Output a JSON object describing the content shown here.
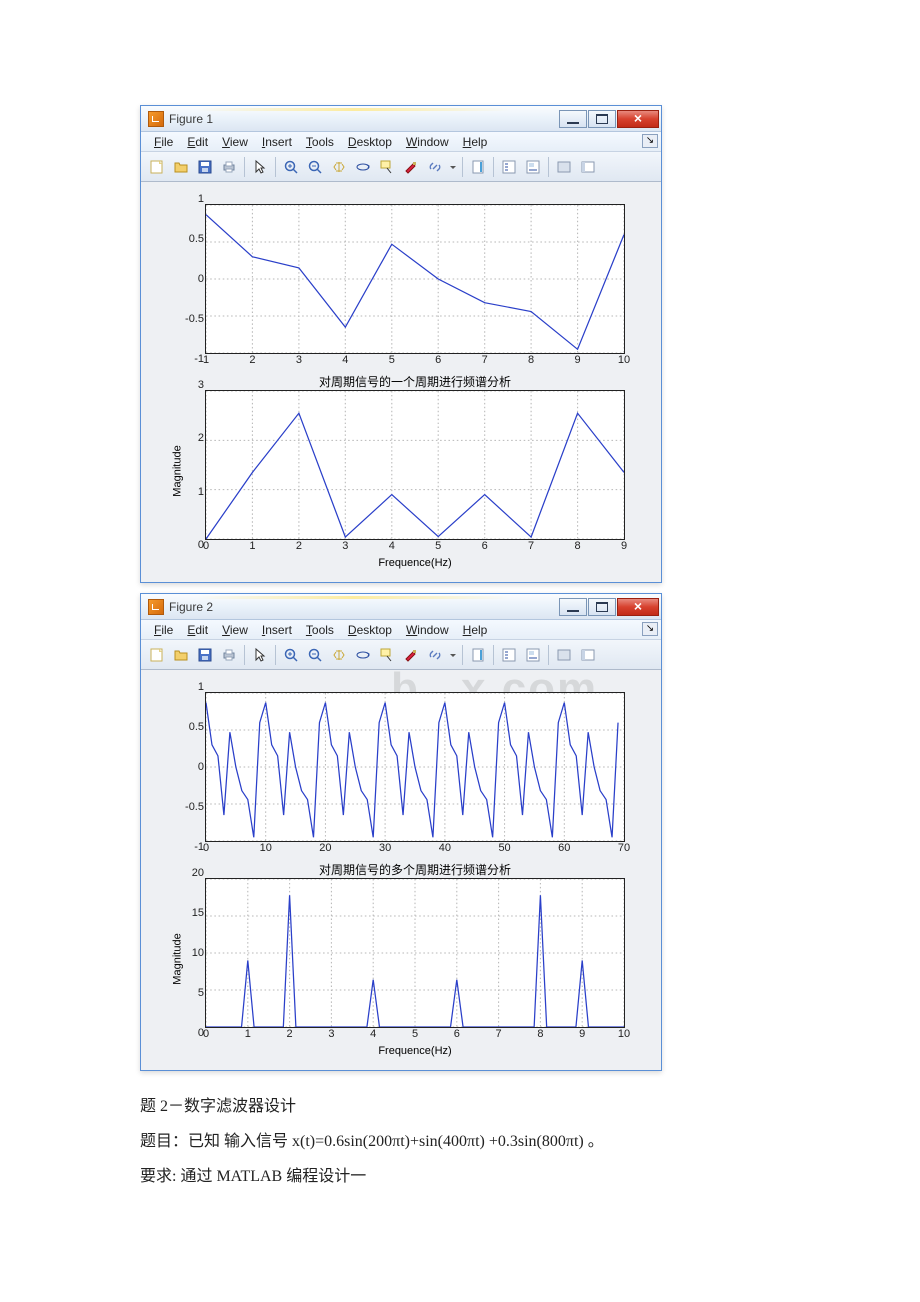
{
  "watermarks": {
    "left": "b",
    "right": "x.com"
  },
  "windows": [
    {
      "title": "Figure 1",
      "menus": [
        "File",
        "Edit",
        "View",
        "Insert",
        "Tools",
        "Desktop",
        "Window",
        "Help"
      ],
      "top_axes": {
        "xticks": [
          1,
          2,
          3,
          4,
          5,
          6,
          7,
          8,
          9,
          10
        ],
        "yticks": [
          -1,
          -0.5,
          0,
          0.5,
          1
        ],
        "xrange": [
          1,
          10
        ],
        "yrange": [
          -1,
          1
        ]
      },
      "bottom_axes": {
        "title": "对周期信号的一个周期进行频谱分析",
        "xlabel": "Frequence(Hz)",
        "ylabel": "Magnitude",
        "xticks": [
          0,
          1,
          2,
          3,
          4,
          5,
          6,
          7,
          8,
          9
        ],
        "yticks": [
          0,
          1,
          2,
          3
        ],
        "xrange": [
          0,
          9
        ],
        "yrange": [
          0,
          3
        ]
      }
    },
    {
      "title": "Figure 2",
      "menus": [
        "File",
        "Edit",
        "View",
        "Insert",
        "Tools",
        "Desktop",
        "Window",
        "Help"
      ],
      "top_axes": {
        "xticks": [
          0,
          10,
          20,
          30,
          40,
          50,
          60,
          70
        ],
        "yticks": [
          -1,
          -0.5,
          0,
          0.5,
          1
        ],
        "xrange": [
          0,
          70
        ],
        "yrange": [
          -1,
          1
        ]
      },
      "bottom_axes": {
        "title": "对周期信号的多个周期进行频谱分析",
        "xlabel": "Frequence(Hz)",
        "ylabel": "Magnitude",
        "xticks": [
          0,
          1,
          2,
          3,
          4,
          5,
          6,
          7,
          8,
          9,
          10
        ],
        "yticks": [
          0,
          5,
          10,
          15,
          20
        ],
        "xrange": [
          0,
          10
        ],
        "yrange": [
          0,
          20
        ]
      }
    }
  ],
  "chart_data": [
    {
      "type": "line",
      "x": [
        1,
        2,
        3,
        4,
        5,
        6,
        7,
        8,
        9,
        10
      ],
      "y": [
        0.87,
        0.3,
        0.15,
        -0.65,
        0.47,
        0.0,
        -0.32,
        -0.44,
        -0.95,
        0.6
      ],
      "xlim": [
        1,
        10
      ],
      "ylim": [
        -1,
        1
      ]
    },
    {
      "type": "line",
      "title": "对周期信号的一个周期进行频谱分析",
      "xlabel": "Frequence(Hz)",
      "ylabel": "Magnitude",
      "x": [
        0,
        1,
        2,
        3,
        4,
        5,
        6,
        7,
        8,
        9
      ],
      "y": [
        0.0,
        1.35,
        2.55,
        0.04,
        0.9,
        0.05,
        0.9,
        0.04,
        2.55,
        1.35
      ],
      "xlim": [
        0,
        9
      ],
      "ylim": [
        0,
        3
      ]
    },
    {
      "type": "line",
      "x_range": [
        0,
        70
      ],
      "series_hint": "7 periods of window0.top signal",
      "xlim": [
        0,
        70
      ],
      "ylim": [
        -1,
        1
      ]
    },
    {
      "type": "line",
      "title": "对周期信号的多个周期进行频谱分析",
      "xlabel": "Frequence(Hz)",
      "ylabel": "Magnitude",
      "peaks": [
        {
          "x": 1.0,
          "y": 9.0
        },
        {
          "x": 2.0,
          "y": 17.8
        },
        {
          "x": 4.0,
          "y": 6.4
        },
        {
          "x": 6.0,
          "y": 6.4
        },
        {
          "x": 8.0,
          "y": 17.8
        },
        {
          "x": 9.0,
          "y": 9.0
        }
      ],
      "xlim": [
        0,
        10
      ],
      "ylim": [
        0,
        20
      ]
    }
  ],
  "text": {
    "line1": "题 2－数字滤波器设计",
    "line2": "题目：已知 输入信号 x(t)=0.6sin(200πt)+sin(400πt) +0.3sin(800πt) 。",
    "line3": "要求: 通过 MATLAB 编程设计一"
  }
}
